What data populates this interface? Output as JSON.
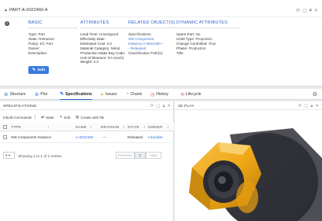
{
  "part": {
    "caret": "▲",
    "title": "PART-A-0022460-A",
    "info_icon": "info-circle-icon",
    "edit_label": "Edit",
    "columns": {
      "basic": {
        "heading": "BASIC",
        "rows": [
          {
            "label": "Type:",
            "value": "Part"
          },
          {
            "label": "State:",
            "value": "Released"
          },
          {
            "label": "Policy:",
            "value": "EC Part"
          },
          {
            "label": "Owner:",
            "value": ""
          },
          {
            "label": "Description:",
            "value": ""
          }
        ]
      },
      "attributes": {
        "heading": "ATTRIBUTES",
        "rows": [
          {
            "label": "Lead Time:",
            "value": "Unassigned"
          },
          {
            "label": "Effectivity Date:",
            "value": ""
          },
          {
            "label": "Estimated Cost:",
            "value": "0.0"
          },
          {
            "label": "Material Category:",
            "value": "Metal"
          },
          {
            "label": "Production Make Buy Code:",
            "value": ""
          },
          {
            "label": "Unit of Measure:",
            "value": "EA (each)"
          },
          {
            "label": "Weight:",
            "value": "0.0"
          }
        ]
      },
      "related": {
        "heading": "RELATED OBJECT(S)",
        "rows": [
          {
            "label": "Specifications:",
            "value": ""
          },
          {
            "label": "",
            "value": "SW Component"
          },
          {
            "label": "",
            "value": "Instance A-0022460---"
          },
          {
            "label": "",
            "value": "- Released"
          },
          {
            "label": "Classification Path(s):",
            "value": ""
          }
        ]
      },
      "dynamic": {
        "heading": "DYNAMIC ATTRIBUTES",
        "rows": [
          {
            "label": "Spare Part:",
            "value": "No"
          },
          {
            "label": "UOM Type:",
            "value": "Proportion"
          },
          {
            "label": "Change Controlled:",
            "value": "True"
          },
          {
            "label": "Phase:",
            "value": "Production"
          },
          {
            "label": "Title:",
            "value": ""
          }
        ]
      }
    }
  },
  "tabs": [
    {
      "label": "Structure",
      "icon": "structure-icon",
      "glyph": "⚙",
      "color": "#3a7be0"
    },
    {
      "label": "Plot",
      "icon": "plot-icon",
      "glyph": "⚙",
      "color": "#3a7be0"
    },
    {
      "label": "Specifications",
      "icon": "specifications-icon",
      "glyph": "✎",
      "color": "#3a7be0",
      "active": true
    },
    {
      "label": "Issues",
      "icon": "warning-icon",
      "glyph": "▲",
      "color": "#e8a317"
    },
    {
      "label": "Charts",
      "icon": "charts-icon",
      "glyph": "◔",
      "color": "#e06a2a"
    },
    {
      "label": "History",
      "icon": "history-icon",
      "glyph": "◷",
      "color": "#d13a3a"
    },
    {
      "label": "Lifecycle",
      "icon": "lifecycle-icon",
      "glyph": "⟲",
      "color": "#b5469b"
    }
  ],
  "specifications": {
    "title": "SPECIFICATIONS",
    "toolbar": {
      "inbuilt": "Inbuilt Commands",
      "state": "State",
      "edit": "Edit",
      "create": "Create with file"
    },
    "columns": {
      "type": "TYPE",
      "name": "NAME",
      "revision": "REVISION",
      "state": "STATE",
      "owner": "OWNER"
    },
    "rows": [
      {
        "type": "SW Component Instance",
        "name": "A-0022460",
        "revision": "---",
        "state": "Released",
        "owner": "mhardisk"
      }
    ],
    "page_size": "5",
    "entries_text": "Showing 1 to 1 of 1 entries",
    "previous": "Previous",
    "page": "1",
    "next": "Next"
  },
  "play": {
    "title": "3D PLAY"
  },
  "colors": {
    "accent": "#2d62c6",
    "link": "#3b78d8",
    "button": "#3a7be0",
    "model_gold": "#f0a817",
    "model_dark": "#2f3036"
  }
}
